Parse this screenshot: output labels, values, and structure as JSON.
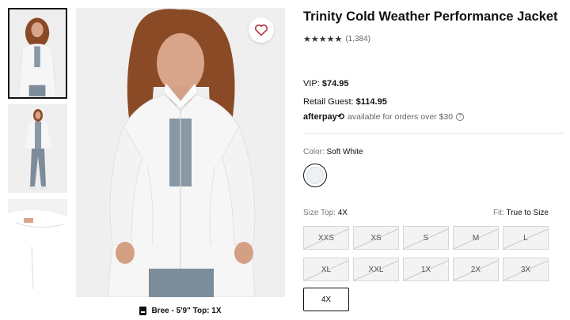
{
  "product": {
    "title": "Trinity Cold Weather Performance Jacket",
    "rating_stars": "★★★★★",
    "review_count": "(1,384)"
  },
  "pricing": {
    "vip_label": "VIP:",
    "vip_price": "$74.95",
    "retail_label": "Retail Guest:",
    "retail_price": "$114.95",
    "afterpay_logo": "afterpay⟲",
    "afterpay_text": "available for orders over $30",
    "afterpay_info": "?"
  },
  "color": {
    "label": "Color:",
    "value": "Soft White",
    "swatch_hex": "#eef1f3"
  },
  "size": {
    "label": "Size Top:",
    "value": "4X",
    "fit_label": "Fit:",
    "fit_value": "True to Size",
    "options": [
      "XXS",
      "XS",
      "S",
      "M",
      "L",
      "XL",
      "XXL",
      "1X",
      "2X",
      "3X",
      "4X"
    ],
    "available": [
      "4X"
    ]
  },
  "model_info": "Bree - 5'9\" Top: 1X",
  "gallery": {
    "thumbnails": [
      "front",
      "full-body",
      "detail"
    ],
    "active_index": 0
  },
  "colors": {
    "jacket": "#f4f5f5",
    "tank": "#8a98a6",
    "hair": "#8a4a26",
    "heart": "#b3303d"
  }
}
